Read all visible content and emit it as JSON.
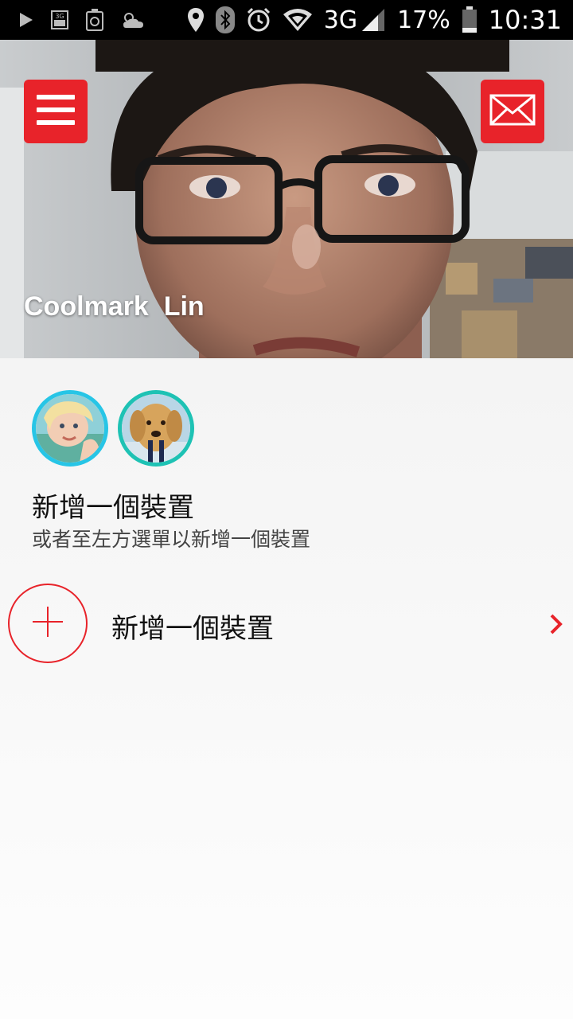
{
  "status_bar": {
    "icons": [
      "play-icon",
      "sim-3g-icon",
      "battery-recycle-icon",
      "weather-icon",
      "location-icon",
      "bluetooth-icon",
      "alarm-icon",
      "wifi-icon",
      "signal-icon",
      "battery-icon"
    ],
    "network": "3G",
    "battery": "17%",
    "time": "10:31"
  },
  "header": {
    "user_name": "Coolmark  Lin",
    "accent_color": "#e8232a",
    "menu_icon": "hamburger-menu-icon",
    "mail_icon": "envelope-icon"
  },
  "devices": {
    "avatars": [
      {
        "name": "device-avatar-child",
        "ring_color": "#27c5e6"
      },
      {
        "name": "device-avatar-dog",
        "ring_color": "#1ec2b4"
      }
    ],
    "title": "新增一個裝置",
    "subtitle": "或者至左方選單以新增一個裝置"
  },
  "add_device": {
    "label": "新增一個裝置",
    "icon": "plus-icon",
    "chevron": "chevron-right-icon"
  }
}
